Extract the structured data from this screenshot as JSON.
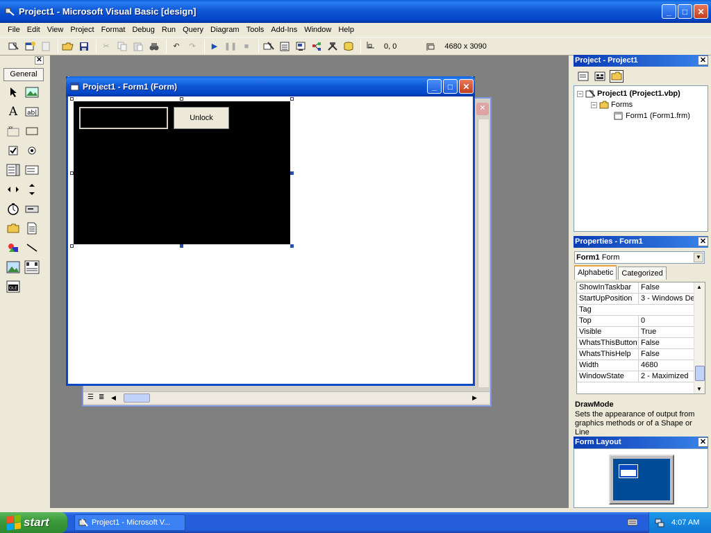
{
  "window": {
    "title": "Project1 - Microsoft Visual Basic [design]",
    "min_glyph": "_",
    "max_glyph": "□",
    "close_glyph": "✕"
  },
  "menu": [
    "File",
    "Edit",
    "View",
    "Project",
    "Format",
    "Debug",
    "Run",
    "Query",
    "Diagram",
    "Tools",
    "Add-Ins",
    "Window",
    "Help"
  ],
  "toolbar": {
    "position_readout": "0, 0",
    "size_readout": "4680 x 3090",
    "icons": [
      "add-project-icon",
      "add-form-icon",
      "menu-editor-icon",
      "open-icon",
      "save-icon",
      "cut-icon",
      "copy-icon",
      "paste-icon",
      "find-icon",
      "undo-icon",
      "redo-icon",
      "start-icon",
      "break-icon",
      "end-icon",
      "project-explorer-icon",
      "properties-window-icon",
      "form-layout-icon",
      "object-browser-icon",
      "toolbox-icon",
      "data-view-icon"
    ]
  },
  "toolbox": {
    "tab_label": "General",
    "close_glyph": "✕",
    "tools": [
      "pointer-icon",
      "picturebox-icon",
      "label-icon",
      "textbox-icon",
      "frame-icon",
      "commandbutton-icon",
      "checkbox-icon",
      "optionbutton-icon",
      "combobox-icon",
      "listbox-icon",
      "hscrollbar-icon",
      "vscrollbar-icon",
      "timer-icon",
      "drivelistbox-icon",
      "dirlistbox-icon",
      "filelistbox-icon",
      "shape-icon",
      "line-icon",
      "image-icon",
      "data-icon",
      "ole-icon"
    ]
  },
  "form_window": {
    "title": "Project1 - Form1 (Form)",
    "button_caption": "Unlock"
  },
  "project_panel": {
    "title": "Project - Project1",
    "close_glyph": "✕",
    "tree": {
      "project": "Project1 (Project1.vbp)",
      "folder": "Forms",
      "form": "Form1 (Form1.frm)"
    }
  },
  "properties_panel": {
    "title": "Properties - Form1",
    "close_glyph": "✕",
    "object_name": "Form1",
    "object_type": "Form",
    "tabs": [
      "Alphabetic",
      "Categorized"
    ],
    "rows": [
      {
        "name": "ShowInTaskbar",
        "value": "False"
      },
      {
        "name": "StartUpPosition",
        "value": "3 - Windows Def"
      },
      {
        "name": "Tag",
        "value": ""
      },
      {
        "name": "Top",
        "value": "0"
      },
      {
        "name": "Visible",
        "value": "True"
      },
      {
        "name": "WhatsThisButton",
        "value": "False"
      },
      {
        "name": "WhatsThisHelp",
        "value": "False"
      },
      {
        "name": "Width",
        "value": "4680"
      },
      {
        "name": "WindowState",
        "value": "2 - Maximized"
      }
    ],
    "description_title": "DrawMode",
    "description_text": "Sets the appearance of output from graphics methods or of a Shape or Line"
  },
  "layout_panel": {
    "title": "Form Layout",
    "close_glyph": "✕"
  },
  "taskbar": {
    "start_label": "start",
    "task_label": "Project1 - Microsoft V...",
    "clock": "4:07 AM"
  },
  "colors": {
    "title_blue": "#0446c8",
    "workspace_gray": "#808080",
    "form_black": "#000000",
    "start_green": "#3c9c3c"
  }
}
